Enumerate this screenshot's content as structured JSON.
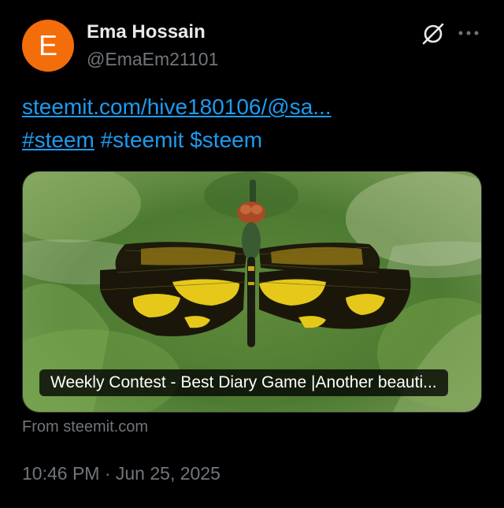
{
  "author": {
    "avatar_letter": "E",
    "avatar_color": "#f46d0b",
    "display_name": "Ema Hossain",
    "handle": "@EmaEm21101"
  },
  "header_icons": [
    "unfollow-icon",
    "more-icon"
  ],
  "tweet": {
    "link_text": "steemit.com/hive180106/@sa...",
    "hashtags": [
      "#steem",
      "#steemit"
    ],
    "cashtag": "$steem"
  },
  "card": {
    "caption": "Weekly Contest - Best Diary Game |Another beauti...",
    "source": "From steemit.com"
  },
  "timestamp": "10:46 PM · Jun 25, 2025",
  "colors": {
    "background": "#000000",
    "link": "#1d9bf0",
    "secondary_text": "#71767b",
    "primary_text": "#e7e9ea"
  }
}
